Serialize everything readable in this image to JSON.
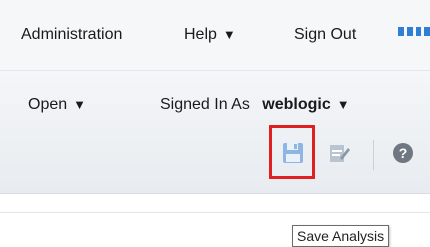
{
  "top_menu": {
    "administration": "Administration",
    "help": "Help",
    "sign_out": "Sign Out"
  },
  "second_menu": {
    "open": "Open",
    "signed_in_as": "Signed In As",
    "username": "weblogic"
  },
  "toolbar": {
    "icons": [
      "save-icon",
      "edit-analysis-icon",
      "help-icon"
    ]
  },
  "tooltip": {
    "text": "Save Analysis"
  },
  "colors": {
    "accent": "#2f7fd6",
    "highlight": "#e02020"
  }
}
